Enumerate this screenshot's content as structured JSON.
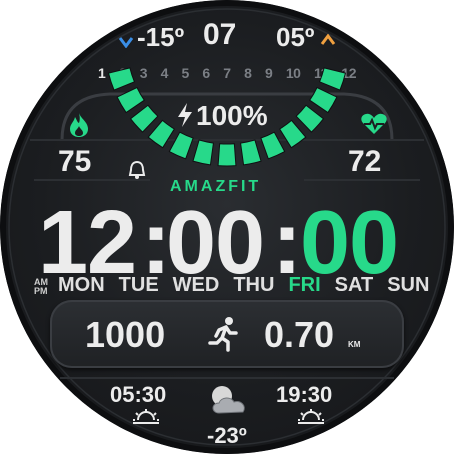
{
  "weather_top": {
    "min_temp": "-15º",
    "day": "07",
    "max_temp": "05º"
  },
  "month_ticks": [
    "1",
    "2",
    "3",
    "4",
    "5",
    "6",
    "7",
    "8",
    "9",
    "10",
    "11",
    "12"
  ],
  "battery": {
    "percent_label": "100%",
    "level": 1.0,
    "segments": 13
  },
  "calories": "75",
  "heart_rate": "72",
  "brand": "AMAZFIT",
  "time": {
    "hours": "12",
    "minutes": "00",
    "seconds": "00",
    "am_pm": [
      "AM",
      "PM"
    ]
  },
  "weekdays": [
    "MON",
    "TUE",
    "WED",
    "THU",
    "FRI",
    "SAT",
    "SUN"
  ],
  "active_weekday": "FRI",
  "activity": {
    "steps": "1000",
    "distance": "0.70",
    "distance_unit": "KM"
  },
  "sun": {
    "sunrise": "05:30",
    "sunset": "19:30"
  },
  "weather": {
    "current_temp": "-23º"
  },
  "colors": {
    "accent": "#27d98a",
    "text": "#ececec",
    "background": "#1b1d20"
  }
}
